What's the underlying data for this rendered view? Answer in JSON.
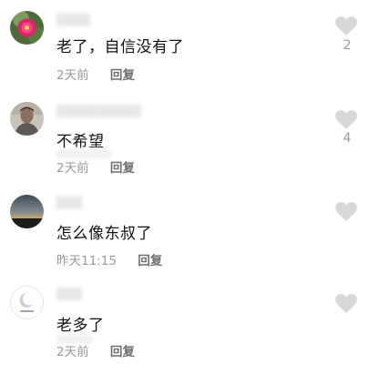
{
  "comments": [
    {
      "text": "老了，自信没有了",
      "time": "2天前",
      "reply": "回复",
      "likes": "2",
      "avatar": "pink-flower-avatar"
    },
    {
      "text": "不希望",
      "time": "2天前",
      "reply": "回复",
      "likes": "4",
      "avatar": "man-portrait-avatar"
    },
    {
      "text": "怎么像东叔了",
      "time": "昨天11:15",
      "reply": "回复",
      "likes": "",
      "avatar": "sunset-landscape-avatar"
    },
    {
      "text": "老多了",
      "time": "2天前",
      "reply": "回复",
      "likes": "",
      "avatar": "moon-logo-avatar"
    }
  ],
  "icons": {
    "like": "heart-icon"
  },
  "colors": {
    "heart": "#d8d8d8",
    "meta": "#9a9a9a",
    "reply": "#6f6f6f",
    "text": "#111111"
  }
}
